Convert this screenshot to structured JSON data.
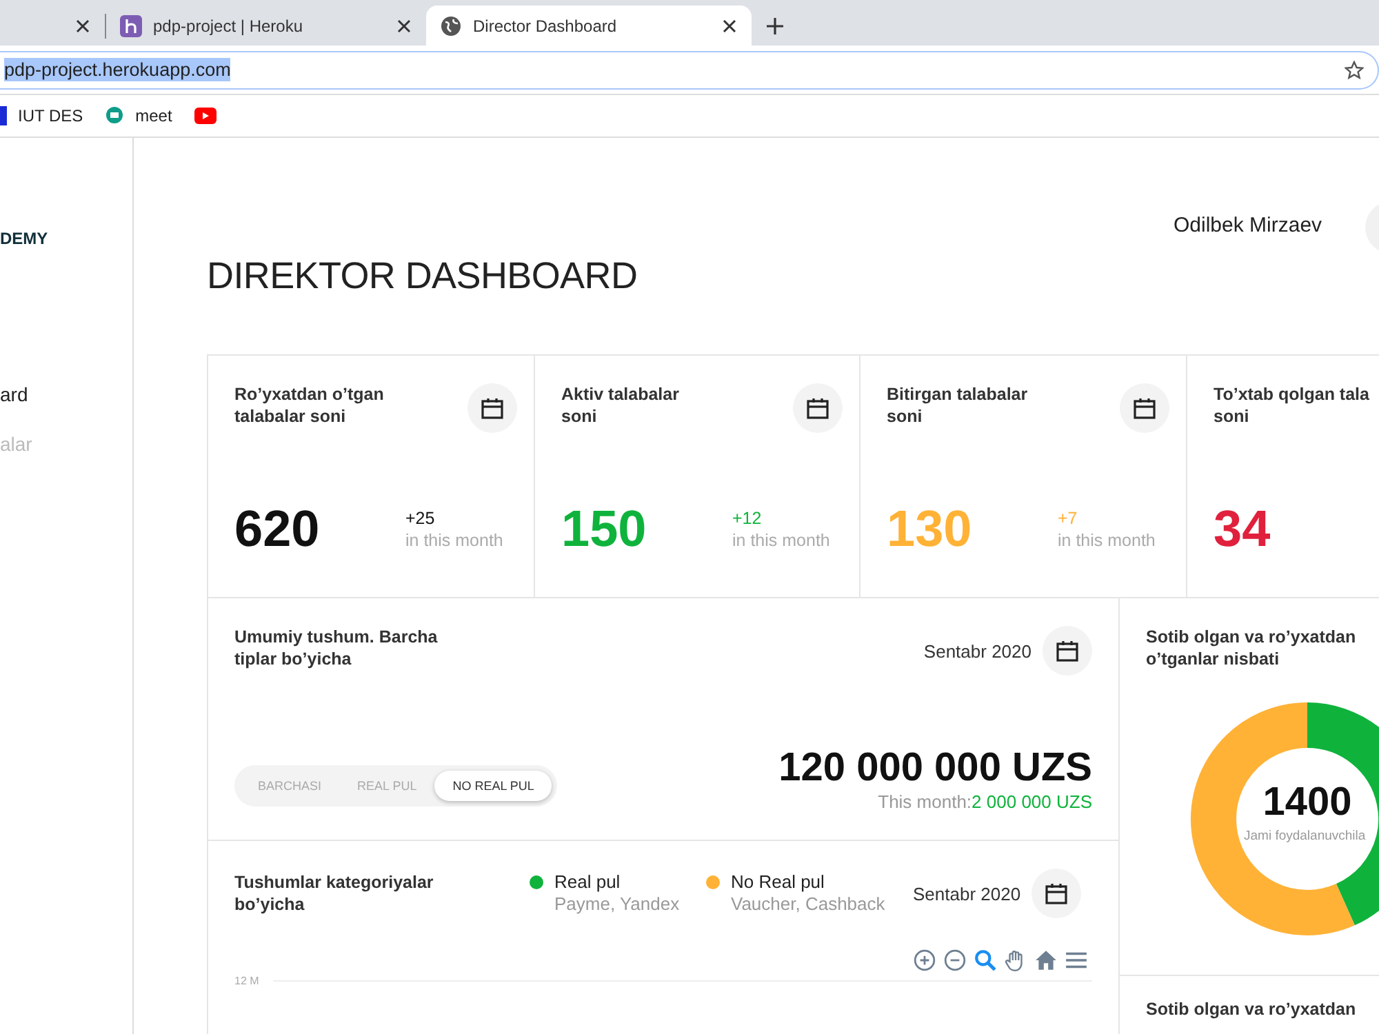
{
  "browser": {
    "tabs": [
      {
        "selected": false
      },
      {
        "title": "pdp-project | Heroku",
        "kind": "app",
        "selected": false
      },
      {
        "title": "Director Dashboard",
        "kind": "site",
        "selected": true
      }
    ],
    "address": {
      "url": "pdp-project.herokuapp.com",
      "highlighted": true
    },
    "bookmarks": [
      {
        "label": "IUT DES",
        "kind": "iut"
      },
      {
        "label": "meet",
        "kind": "meet"
      },
      {
        "kind": "youtube"
      }
    ]
  },
  "sidebar": {
    "logo": "DEMY",
    "items": [
      {
        "label": "ard",
        "selected": true
      },
      {
        "label": "alar",
        "selected": false
      }
    ]
  },
  "header": {
    "title": "DIREKTOR DASHBOARD",
    "user": "Odilbek Mirzaev"
  },
  "stats": [
    {
      "title": "Ro’yxatdan o’tgan\ntalabalar soni",
      "value": "620",
      "color": "#111111",
      "delta": "+25",
      "note": "in this month"
    },
    {
      "title": "Aktiv talabalar\nsoni",
      "value": "150",
      "color": "#0fb33c",
      "delta": "+12",
      "note": "in this month"
    },
    {
      "title": "Bitirgan talabalar\nsoni",
      "value": "130",
      "color": "#ffb236",
      "delta": "+7",
      "note": "in this month"
    },
    {
      "title": "To’xtab qolgan tala\nsoni",
      "value": "34",
      "color": "#e0203c"
    }
  ],
  "revenue": {
    "title": "Umumiy tushum. Barcha\ntiplar bo’yicha",
    "period": "Sentabr 2020",
    "filters": [
      {
        "label": "BARCHASI",
        "selected": false
      },
      {
        "label": "REAL PUL",
        "selected": false
      },
      {
        "label": "NO REAL PUL",
        "selected": true
      }
    ],
    "total": "120 000 000 UZS",
    "month_label": "This month:",
    "month_value": "2 000 000 UZS"
  },
  "ratio": {
    "title": "Sotib olgan va ro’yxatdan\no’tganlar nisbati",
    "total": "1400",
    "caption": "Jami foydalanuvchila",
    "segments": [
      {
        "color": "#0fb33c"
      },
      {
        "color": "#ffb236"
      }
    ]
  },
  "categories": {
    "title": "Tushumlar kategoriyalar\nbo’yicha",
    "legend": [
      {
        "name": "Real pul",
        "note": "Payme, Yandex",
        "color": "#0fb33c"
      },
      {
        "name": "No Real pul",
        "note": "Vaucher, Cashback",
        "color": "#ffb236"
      }
    ],
    "period": "Sentabr 2020",
    "toolbar": [
      {
        "kind": "zoom-in",
        "selected": false
      },
      {
        "kind": "zoom-out",
        "selected": false
      },
      {
        "kind": "zoom",
        "selected": true
      },
      {
        "kind": "pan",
        "selected": false
      },
      {
        "kind": "home",
        "selected": false
      },
      {
        "kind": "menu",
        "selected": false
      }
    ],
    "y_label": "12 M"
  },
  "next_card": {
    "title": "Sotib olgan va ro’yxatdan"
  }
}
